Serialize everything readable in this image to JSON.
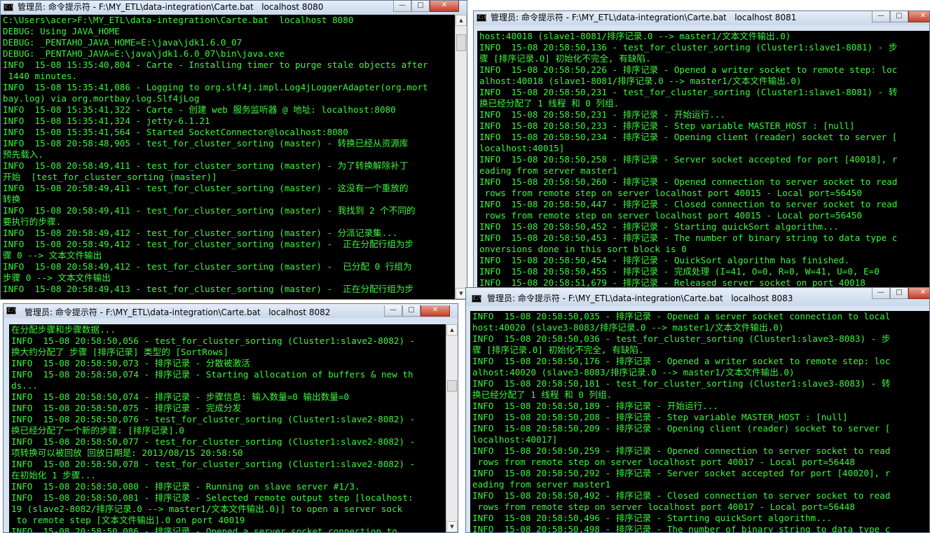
{
  "icon_label": "C:\\",
  "windows": [
    {
      "title": "管理员: 命令提示符 - F:\\MY_ETL\\data-integration\\Carte.bat   localhost 8080",
      "lines": [
        "C:\\Users\\acer>F:\\MY_ETL\\data-integration\\Carte.bat  localhost 8080",
        "DEBUG: Using JAVA_HOME",
        "DEBUG: _PENTAHO_JAVA_HOME=E:\\java\\jdk1.6.0_07",
        "DEBUG: _PENTAHO_JAVA=E:\\java\\jdk1.6.0_07\\bin\\java.exe",
        "INFO  15-08 15:35:40,804 - Carte - Installing timer to purge stale objects after",
        " 1440 minutes.",
        "INFO  15-08 15:35:41,086 - Logging to org.slf4j.impl.Log4jLoggerAdapter(org.mort",
        "bay.log) via org.mortbay.log.Slf4jLog",
        "INFO  15-08 15:35:41,322 - Carte - 创建 web 服务监听器 @ 地址: localhost:8080",
        "INFO  15-08 15:35:41,324 - jetty-6.1.21",
        "INFO  15-08 15:35:41,564 - Started SocketConnector@localhost:8080",
        "INFO  15-08 20:58:48,905 - test_for_cluster_sorting (master) - 转换已经从资源库",
        "预先载入.",
        "INFO  15-08 20:58:49,411 - test_for_cluster_sorting (master) - 为了转换解除补丁",
        "开始  [test_for_cluster_sorting (master)]",
        "INFO  15-08 20:58:49,411 - test_for_cluster_sorting (master) - 这没有一个重放的",
        "转换",
        "INFO  15-08 20:58:49,411 - test_for_cluster_sorting (master) - 我找到 2 个不同的",
        "要执行的步骤.",
        "INFO  15-08 20:58:49,412 - test_for_cluster_sorting (master) - 分派记录集...",
        "INFO  15-08 20:58:49,412 - test_for_cluster_sorting (master) -  正在分配行组为步",
        "骤 0 --> 文本文件输出",
        "INFO  15-08 20:58:49,412 - test_for_cluster_sorting (master) -  已分配 0 行组为",
        "步骤 0 --> 文本文件输出",
        "INFO  15-08 20:58:49,413 - test_for_cluster_sorting (master) -  正在分配行组为步"
      ]
    },
    {
      "title": "管理员: 命令提示符 - F:\\MY_ETL\\data-integration\\Carte.bat   localhost 8081",
      "lines": [
        "host:40018 (slave1-8081/排序记录.0 --> master1/文本文件输出.0)",
        "INFO  15-08 20:58:50,136 - test_for_cluster_sorting (Cluster1:slave1-8081) - 步",
        "骤 [排序记录.0] 初始化不完全, 有缺陷.",
        "INFO  15-08 20:58:50,226 - 排序记录 - Opened a writer socket to remote step: loc",
        "alhost:40018 (slave1-8081/排序记录.0 --> master1/文本文件输出.0)",
        "INFO  15-08 20:58:50,231 - test_for_cluster_sorting (Cluster1:slave1-8081) - 转",
        "换已经分配了 1 线程 和 0 列组.",
        "INFO  15-08 20:58:50,231 - 排序记录 - 开始运行...",
        "INFO  15-08 20:58:50,233 - 排序记录 - Step variable MASTER_HOST : [null]",
        "INFO  15-08 20:58:50,234 - 排序记录 - Opening client (reader) socket to server [",
        "localhost:40015]",
        "INFO  15-08 20:58:50,258 - 排序记录 - Server socket accepted for port [40018], r",
        "eading from server master1",
        "INFO  15-08 20:58:50,260 - 排序记录 - Opened connection to server socket to read",
        " rows from remote step on server localhost port 40015 - Local port=56450",
        "INFO  15-08 20:58:50,447 - 排序记录 - Closed connection to server socket to read",
        " rows from remote step on server localhost port 40015 - Local port=56450",
        "INFO  15-08 20:58:50,452 - 排序记录 - Starting quickSort algorithm...",
        "INFO  15-08 20:58:50,453 - 排序记录 - The number of binary string to data type c",
        "onversions done in this sort block is 0",
        "INFO  15-08 20:58:50,454 - 排序记录 - QuickSort algorithm has finished.",
        "INFO  15-08 20:58:50,455 - 排序记录 - 完成处理 (I=41, O=0, R=0, W=41, U=0, E=0",
        "INFO  15-08 20:58:51,679 - 排序记录 - Released server socket on port 40018"
      ]
    },
    {
      "title": "管理员: 命令提示符 - F:\\MY_ETL\\data-integration\\Carte.bat   localhost 8082",
      "lines": [
        "在分配步骤和步骤数据...",
        "INFO  15-08 20:58:50,056 - test_for_cluster_sorting (Cluster1:slave2-8082) -",
        "换大约分配了 步骤 [排序记录] 类型的 [SortRows]",
        "INFO  15-08 20:58:50,073 - 排序记录 - 分散被激活",
        "INFO  15-08 20:58:50,074 - 排序记录 - Starting allocation of buffers & new th",
        "ds...",
        "INFO  15-08 20:58:50,074 - 排序记录 - 步骤信息: 输入数量=0 输出数量=0",
        "INFO  15-08 20:58:50,075 - 排序记录 - 完成分发",
        "INFO  15-08 20:58:50,076 - test_for_cluster_sorting (Cluster1:slave2-8082) -",
        "换已经分配了一个新的步骤: [排序记录].0",
        "INFO  15-08 20:58:50,077 - test_for_cluster_sorting (Cluster1:slave2-8082) -",
        "项转换可以被回放 回放日期是: 2013/08/15 20:58:50",
        "INFO  15-08 20:58:50,078 - test_for_cluster_sorting (Cluster1:slave2-8082) -",
        "在初始化 1 步骤...",
        "INFO  15-08 20:58:50,080 - 排序记录 - Running on slave server #1/3.",
        "INFO  15-08 20:58:50,081 - 排序记录 - Selected remote output step [localhost:",
        "19 (slave2-8082/排序记录.0 --> master1/文本文件输出.0)] to open a server sock",
        " to remote step [文本文件输出].0 on port 40019",
        "INFO  15-08 20:58:50,086 - 排序记录 - Opened a server socket connection to"
      ]
    },
    {
      "title": "管理员: 命令提示符 - F:\\MY_ETL\\data-integration\\Carte.bat   localhost 8083",
      "lines": [
        "INFO  15-08 20:58:50,035 - 排序记录 - Opened a server socket connection to local",
        "host:40020 (slave3-8083/排序记录.0 --> master1/文本文件输出.0)",
        "INFO  15-08 20:58:50,036 - test_for_cluster_sorting (Cluster1:slave3-8083) - 步",
        "骤 [排序记录.0] 初始化不完全, 有缺陷.",
        "INFO  15-08 20:58:50,176 - 排序记录 - Opened a writer socket to remote step: loc",
        "alhost:40020 (slave3-8083/排序记录.0 --> master1/文本文件输出.0)",
        "INFO  15-08 20:58:50,181 - test_for_cluster_sorting (Cluster1:slave3-8083) - 转",
        "换已经分配了 1 线程 和 0 列组.",
        "INFO  15-08 20:58:50,189 - 排序记录 - 开始运行...",
        "INFO  15-08 20:58:50,208 - 排序记录 - Step variable MASTER_HOST : [null]",
        "INFO  15-08 20:58:50,209 - 排序记录 - Opening client (reader) socket to server [",
        "localhost:40017]",
        "INFO  15-08 20:58:50,259 - 排序记录 - Opened connection to server socket to read",
        " rows from remote step on server localhost port 40017 - Local port=56448",
        "INFO  15-08 20:58:50,292 - 排序记录 - Server socket accepted for port [40020], r",
        "eading from server master1",
        "INFO  15-08 20:58:50,492 - 排序记录 - Closed connection to server socket to read",
        " rows from remote step on server localhost port 40017 - Local port=56448",
        "INFO  15-08 20:58:50,496 - 排序记录 - Starting quickSort algorithm...",
        "INFO  15-08 20:58:50,498 - 排序记录 - The number of binary string to data type c"
      ]
    }
  ]
}
